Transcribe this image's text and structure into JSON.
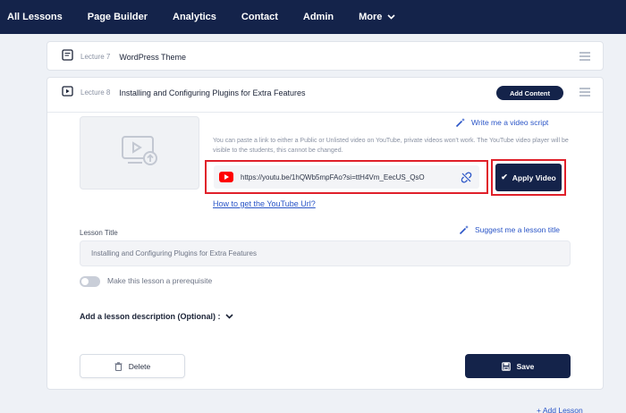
{
  "nav": {
    "items": [
      "All Lessons",
      "Page Builder",
      "Analytics",
      "Contact",
      "Admin"
    ],
    "more_label": "More"
  },
  "lesson7": {
    "number": "Lecture 7",
    "title": "WordPress Theme"
  },
  "lesson8": {
    "number": "Lecture 8",
    "title": "Installing and Configuring Plugins for Extra Features",
    "add_content_label": "Add Content",
    "write_script_label": "Write me a video script",
    "help_text": "You can paste a link to either a Public or Unlisted video on YouTube, private videos won't work. The YouTube video player will be visible to the students, this cannot be changed.",
    "video_url": "https://youtu.be/1hQWb5mpFAo?si=ttH4Vm_EecUS_QsO",
    "apply_label": "Apply Video",
    "how_to_link": "How to get the YouTube Url?",
    "lesson_title_label": "Lesson Title",
    "suggest_label": "Suggest me a lesson title",
    "lesson_title_value": "Installing and Configuring Plugins for Extra Features",
    "prerequisite_label": "Make this lesson a prerequisite",
    "prerequisite_on": false,
    "description_toggle": "Add a lesson description (Optional) :",
    "delete_label": "Delete",
    "save_label": "Save"
  },
  "add_lesson_label": "+ Add Lesson",
  "colors": {
    "navy": "#14234a",
    "link_blue": "#2a55c7",
    "highlight_red": "#e0202a",
    "youtube_red": "#ff0000"
  }
}
